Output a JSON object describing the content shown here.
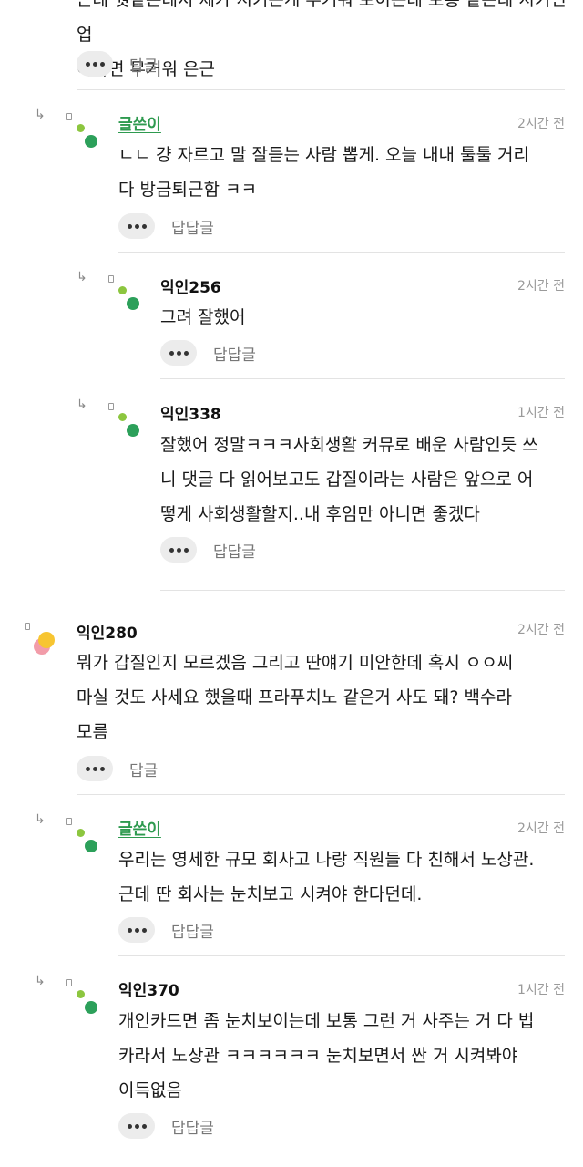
{
  "comments": [
    {
      "id": "c0",
      "body_lines": [
        "근데 뭣같은데서 제가 시키는게 무거워 보이는데 보통 같은데 시키면 업",
        "어가면 무거워 은근"
      ],
      "reply_label": "답글"
    },
    {
      "id": "c1",
      "author": "글쓴이",
      "time": "2시간 전",
      "body_lines": [
        "ㄴㄴ 걍 자르고 말 잘듣는 사람 뽑게. 오늘 내내 툴툴 거리",
        "다 방금퇴근함 ㅋㅋ"
      ],
      "reply_label": "답답글"
    },
    {
      "id": "c2",
      "author": "익인256",
      "time": "2시간 전",
      "body_lines": [
        "그려 잘했어"
      ],
      "reply_label": "답답글"
    },
    {
      "id": "c3",
      "author": "익인338",
      "time": "1시간 전",
      "body_lines": [
        "잘했어 정말ㅋㅋㅋ사회생활 커뮤로 배운 사람인듯 쓰",
        "니 댓글 다 읽어보고도 갑질이라는 사람은 앞으로 어",
        "떻게 사회생활할지..내 후임만 아니면 좋겠다"
      ],
      "reply_label": "답답글"
    },
    {
      "id": "c4",
      "author": "익인280",
      "time": "2시간 전",
      "body_lines": [
        "뭐가 갑질인지 모르겠음 그리고 딴얘기 미안한데 혹시 ㅇㅇ씨",
        "마실 것도 사세요 했을때 프라푸치노 같은거 사도 돼? 백수라",
        "모름"
      ],
      "reply_label": "답글"
    },
    {
      "id": "c5",
      "author": "글쓴이",
      "time": "2시간 전",
      "body_lines": [
        "우리는 영세한 규모 회사고 나랑 직원들 다 친해서 노상관.",
        "근데 딴 회사는 눈치보고 시켜야 한다던데."
      ],
      "reply_label": "답답글"
    },
    {
      "id": "c6",
      "author": "익인370",
      "time": "1시간 전",
      "body_lines": [
        "개인카드면 좀 눈치보이는데 보통 그런 거 사주는 거 다 법",
        "카라서 노상관 ㅋㅋㅋㅋㅋㅋ 눈치보면서 싼 거 시켜봐야",
        "이득없음"
      ],
      "reply_label": "답답글"
    }
  ],
  "icons": {
    "reply_arrow": "↳",
    "avatar_green_dots": "green-dots-avatar",
    "avatar_yellow_pink": "yellow-pink-avatar",
    "more": "more-dots"
  },
  "colors": {
    "op_author": "#2e9a4f",
    "avatar_light_green": "#8cc63f",
    "avatar_dark_green": "#2ca05a",
    "avatar_yellow": "#f7c531",
    "avatar_pink": "#f29ca9"
  }
}
